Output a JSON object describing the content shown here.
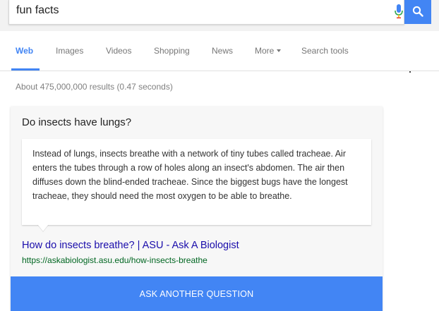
{
  "search": {
    "query": "fun facts"
  },
  "colors": {
    "accent": "#4285f4",
    "link": "#1a0dab",
    "url": "#006621"
  },
  "icons": {
    "mic": "microphone-icon",
    "search": "search-icon",
    "caret": "caret-down-icon"
  },
  "tabs": [
    {
      "label": "Web",
      "active": true
    },
    {
      "label": "Images",
      "active": false
    },
    {
      "label": "Videos",
      "active": false
    },
    {
      "label": "Shopping",
      "active": false
    },
    {
      "label": "News",
      "active": false
    },
    {
      "label": "More",
      "active": false
    },
    {
      "label": "Search tools",
      "active": false
    }
  ],
  "result_stats": "About 475,000,000 results (0.47 seconds)",
  "featured": {
    "question": "Do insects have lungs?",
    "answer": "Instead of lungs, insects breathe with a network of tiny tubes called tracheae. Air enters the tubes through a row of holes along an insect's abdomen. The air then diffuses down the blind-ended tracheae. Since the biggest bugs have the longest tracheae, they should need the most oxygen to be able to breathe.",
    "source_title": "How do insects breathe? | ASU - Ask A Biologist",
    "source_url": "https://askabiologist.asu.edu/how-insects-breathe",
    "button_label": "ASK ANOTHER QUESTION"
  }
}
